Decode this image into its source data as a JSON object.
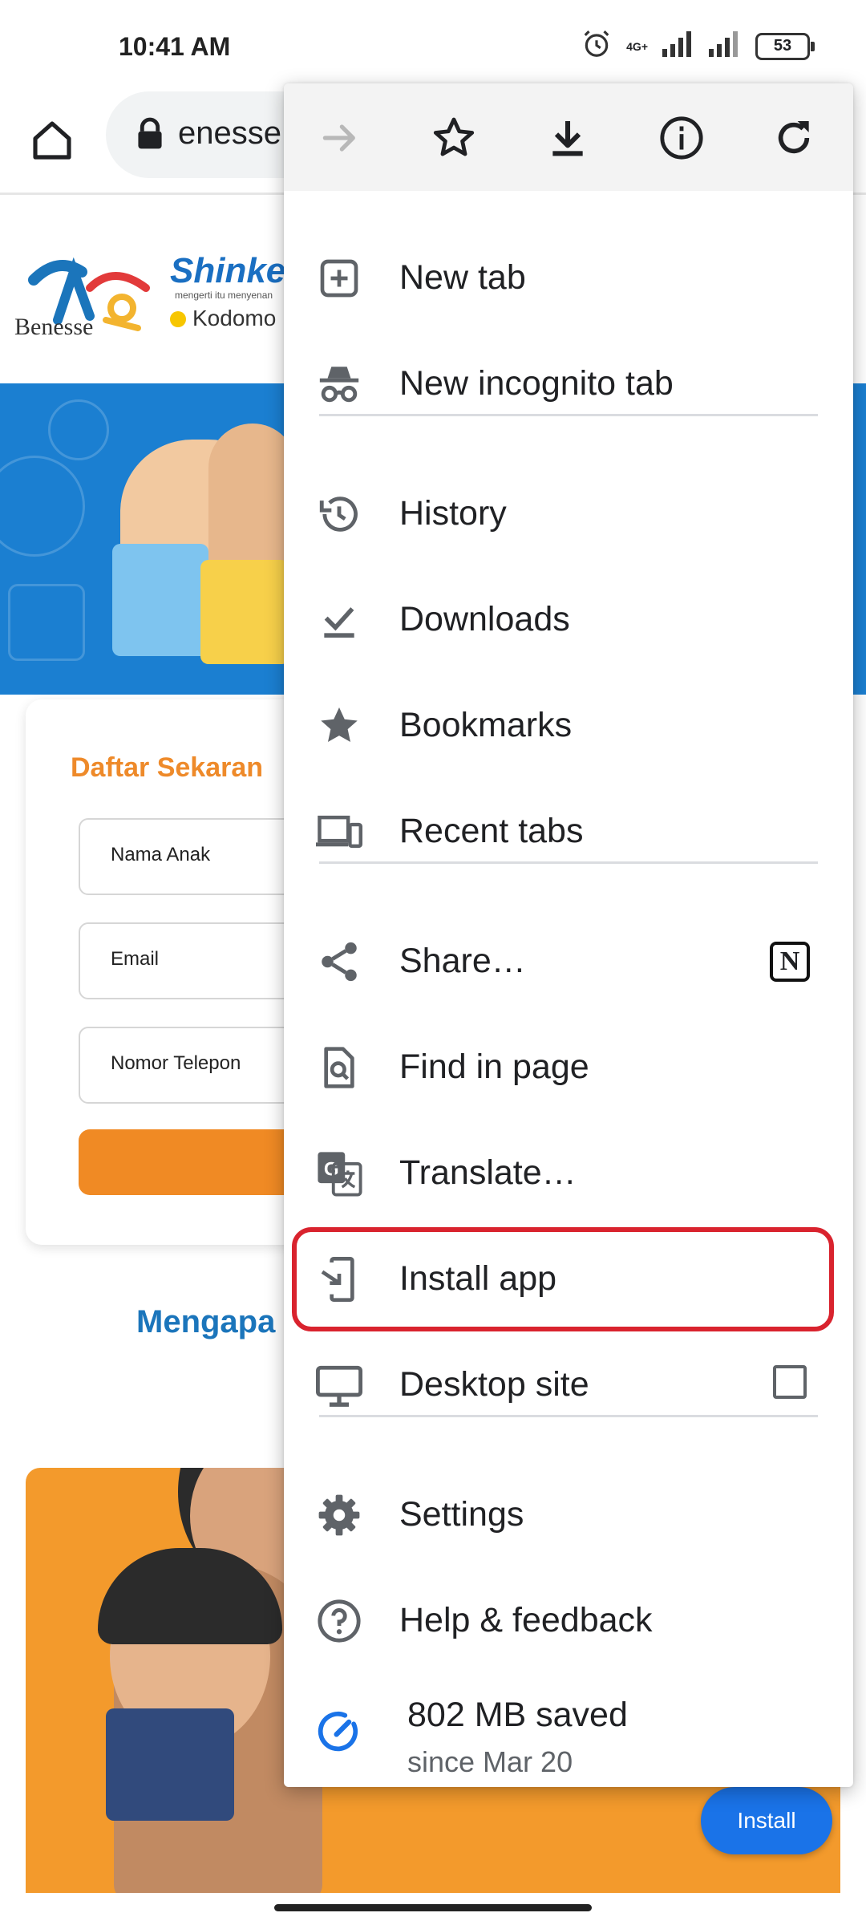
{
  "status_bar": {
    "time": "10:41 AM",
    "network_label": "4G+",
    "battery": "53",
    "icons": [
      "alarm-icon",
      "signal-icon",
      "signal-icon-2",
      "battery-icon"
    ]
  },
  "toolbar": {
    "url_fragment": "enesse",
    "icons": [
      "home-icon",
      "lock-icon"
    ]
  },
  "page": {
    "logo_benesse": "Benesse",
    "logo_shinkenzemi": "Shinke",
    "logo_tagline": "mengerti itu menyenan",
    "logo_kodomo": "Kodomo",
    "form_title": "Daftar Sekaran",
    "fields": [
      {
        "placeholder": "Nama Anak"
      },
      {
        "placeholder": "Email"
      },
      {
        "placeholder": "Nomor Telepon"
      }
    ],
    "why_title": "Mengapa",
    "install_chip": "Install"
  },
  "menu": {
    "actions": [
      "forward-icon",
      "bookmark-star-icon",
      "download-icon",
      "info-icon",
      "refresh-icon"
    ],
    "items": [
      {
        "label": "New tab",
        "icon": "new-tab-icon"
      },
      {
        "label": "New incognito tab",
        "icon": "incognito-icon"
      },
      {
        "label": "History",
        "icon": "history-icon"
      },
      {
        "label": "Downloads",
        "icon": "downloads-icon"
      },
      {
        "label": "Bookmarks",
        "icon": "bookmarks-icon"
      },
      {
        "label": "Recent tabs",
        "icon": "recent-tabs-icon"
      },
      {
        "label": "Share…",
        "icon": "share-icon",
        "extra": "N"
      },
      {
        "label": "Find in page",
        "icon": "find-in-page-icon"
      },
      {
        "label": "Translate…",
        "icon": "translate-icon"
      },
      {
        "label": "Install app",
        "icon": "install-app-icon",
        "highlighted": true
      },
      {
        "label": "Desktop site",
        "icon": "desktop-icon",
        "checked": false
      },
      {
        "label": "Settings",
        "icon": "settings-icon"
      },
      {
        "label": "Help & feedback",
        "icon": "help-icon"
      }
    ],
    "data_saver": {
      "main": "802 MB saved",
      "sub": "since Mar 20",
      "icon": "data-saver-icon"
    },
    "highlight_color": "#d9232e"
  }
}
